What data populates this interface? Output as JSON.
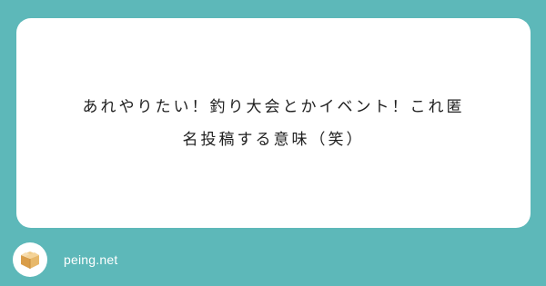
{
  "question": {
    "text": "あれやりたい！釣り大会とかイベント！これ匿\n名投稿する意味（笑）"
  },
  "footer": {
    "brand": "peing.net",
    "logo_icon": "cardboard-box-icon"
  },
  "colors": {
    "background": "#5db8b9",
    "card": "#ffffff",
    "text": "#1f1f1f",
    "box_fill": "#e7b86a",
    "box_shadow": "#c9903e"
  }
}
